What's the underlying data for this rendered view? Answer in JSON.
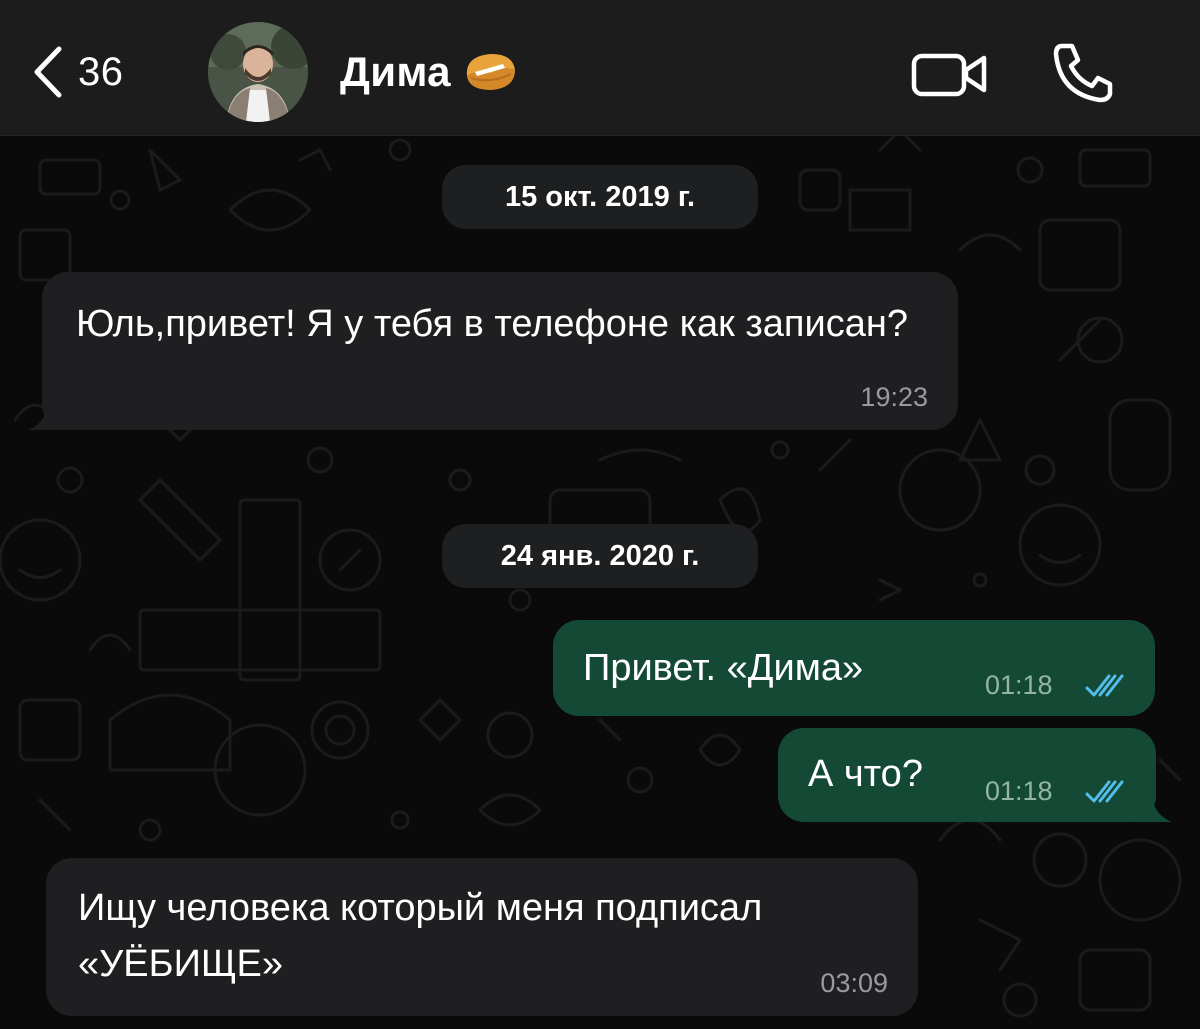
{
  "header": {
    "back_count": "36",
    "contact_name": "Дима",
    "status_emoji": "fortune-cookie-emoji"
  },
  "dates": [
    {
      "label": "15 окт. 2019 г."
    },
    {
      "label": "24 янв. 2020 г."
    }
  ],
  "messages": [
    {
      "direction": "incoming",
      "text": "Юль,привет! Я у тебя в телефоне как записан?",
      "time": "19:23"
    },
    {
      "direction": "outgoing",
      "text": "Привет. «Дима»",
      "time": "01:18",
      "status": "read"
    },
    {
      "direction": "outgoing",
      "text": "А что?",
      "time": "01:18",
      "status": "read"
    },
    {
      "direction": "incoming",
      "text": "Ищу человека который меня подписал «УЁБИЩЕ»",
      "time": "03:09"
    }
  ],
  "icons": {
    "back": "chevron-left-icon",
    "video": "video-camera-icon",
    "phone": "phone-icon",
    "read_receipt": "double-check-icon"
  },
  "colors": {
    "header_bg": "#1c1c1d",
    "chat_bg": "#0a0a0a",
    "incoming_bubble": "#1f1f21",
    "outgoing_bubble": "#144a35",
    "read_check": "#53bdeb"
  }
}
